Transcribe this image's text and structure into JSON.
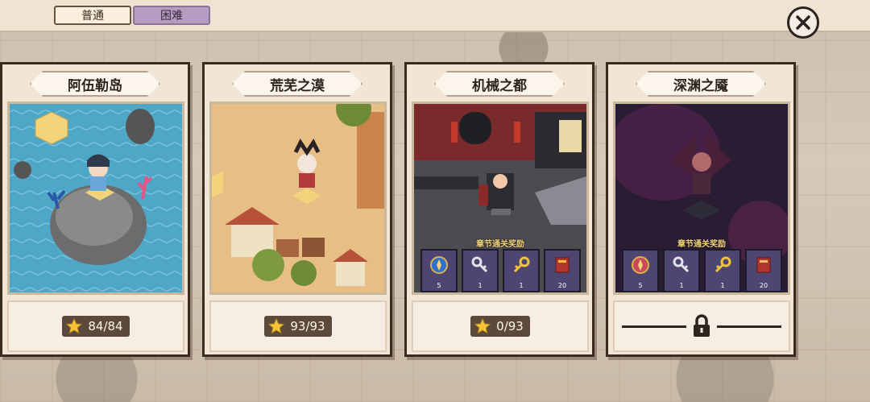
{
  "tabs": [
    {
      "label": "普通",
      "active": true
    },
    {
      "label": "困难",
      "active": false
    }
  ],
  "close_icon": "close-icon",
  "cards": [
    {
      "title": "阿伍勒岛",
      "stars": "84/84",
      "locked": false
    },
    {
      "title": "荒芜之漠",
      "stars": "93/93",
      "locked": false
    },
    {
      "title": "机械之都",
      "stars": "0/93",
      "locked": false,
      "rewards_label": "章节通关奖励",
      "rewards": [
        {
          "icon": "compass-icon",
          "count": "5"
        },
        {
          "icon": "silver-key-icon",
          "count": "1"
        },
        {
          "icon": "gold-key-icon",
          "count": "1"
        },
        {
          "icon": "book-icon",
          "count": "20"
        }
      ]
    },
    {
      "title": "深渊之魇",
      "locked": true,
      "rewards_label": "章节通关奖励",
      "rewards": [
        {
          "icon": "compass-icon",
          "count": "5"
        },
        {
          "icon": "silver-key-icon",
          "count": "1"
        },
        {
          "icon": "gold-key-icon",
          "count": "1"
        },
        {
          "icon": "book-icon",
          "count": "20"
        }
      ]
    }
  ],
  "colors": {
    "sea": "#4fa7c8",
    "desert": "#e3b77b",
    "mech": "#3a3a40",
    "abyss": "#3b2440",
    "star": "#f5c43a"
  }
}
